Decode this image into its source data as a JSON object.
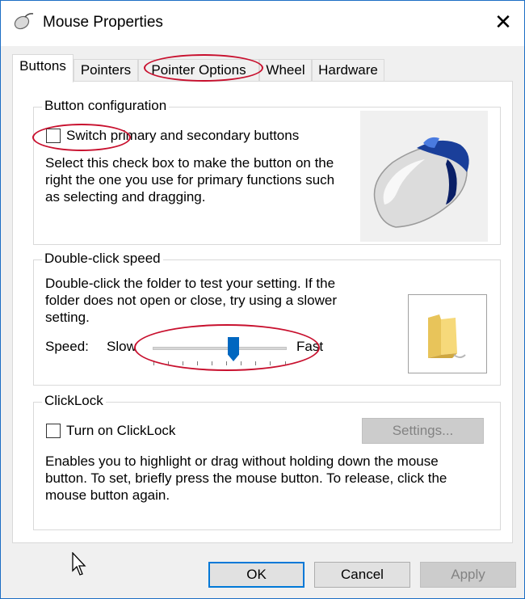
{
  "window": {
    "title": "Mouse Properties",
    "close_glyph": "✕"
  },
  "tabs": [
    {
      "label": "Buttons",
      "active": true
    },
    {
      "label": "Pointers",
      "active": false
    },
    {
      "label": "Pointer Options",
      "active": false
    },
    {
      "label": "Wheel",
      "active": false
    },
    {
      "label": "Hardware",
      "active": false
    }
  ],
  "button_config": {
    "group_label": "Button configuration",
    "switch_label": "Switch primary and secondary buttons",
    "switch_checked": false,
    "desc_lines": [
      "Select this check box to make the button on the",
      "right the one you use for primary functions such",
      "as selecting and dragging."
    ]
  },
  "double_click": {
    "group_label": "Double-click speed",
    "desc_lines": [
      "Double-click the folder to test your setting. If the",
      "folder does not open or close, try using a slower",
      "setting."
    ],
    "speed_label": "Speed:",
    "slow_label": "Slow",
    "fast_label": "Fast",
    "slider_value": 0.6
  },
  "clicklock": {
    "group_label": "ClickLock",
    "turn_on_label": "Turn on ClickLock",
    "turn_on_checked": false,
    "settings_label": "Settings...",
    "desc_lines": [
      "Enables you to highlight or drag without holding down the mouse",
      "button. To set, briefly press the mouse button. To release, click the",
      "mouse button again."
    ]
  },
  "footer": {
    "ok": "OK",
    "cancel": "Cancel",
    "apply": "Apply"
  },
  "colors": {
    "annotation": "#c8102e",
    "accent": "#0078d7",
    "slider_thumb": "#0067c0"
  }
}
